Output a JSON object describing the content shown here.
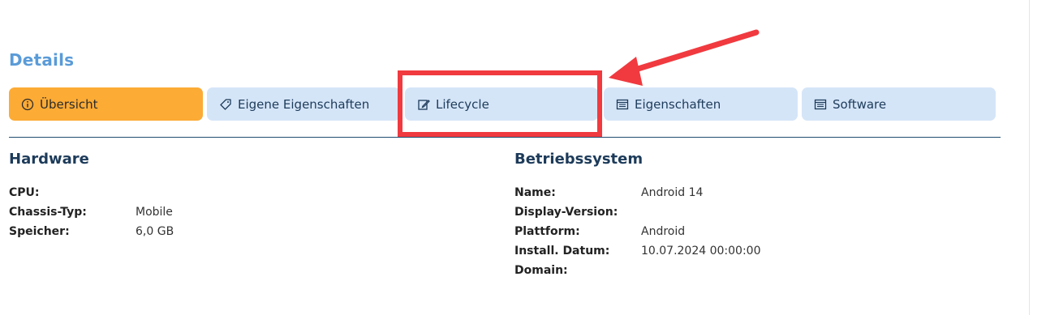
{
  "page": {
    "title": "Details"
  },
  "tabs": [
    {
      "label": "Übersicht",
      "icon": "info-circle-icon",
      "active": true
    },
    {
      "label": "Eigene Eigenschaften",
      "icon": "tag-icon",
      "active": false
    },
    {
      "label": "Lifecycle",
      "icon": "edit-icon",
      "active": false
    },
    {
      "label": "Eigenschaften",
      "icon": "list-icon",
      "active": false
    },
    {
      "label": "Software",
      "icon": "list-icon",
      "active": false
    }
  ],
  "hardware": {
    "title": "Hardware",
    "rows": [
      {
        "key": "CPU:",
        "value": ""
      },
      {
        "key": "Chassis-Typ:",
        "value": "Mobile"
      },
      {
        "key": "Speicher:",
        "value": "6,0 GB"
      }
    ]
  },
  "os": {
    "title": "Betriebssystem",
    "rows": [
      {
        "key": "Name:",
        "value": "Android 14"
      },
      {
        "key": "Display-Version:",
        "value": ""
      },
      {
        "key": "Plattform:",
        "value": "Android"
      },
      {
        "key": "Install. Datum:",
        "value": "10.07.2024 00:00:00"
      },
      {
        "key": "Domain:",
        "value": ""
      }
    ]
  },
  "annotation": {
    "highlight_color": "#f03a3f",
    "highlighted_tab": "Lifecycle"
  }
}
